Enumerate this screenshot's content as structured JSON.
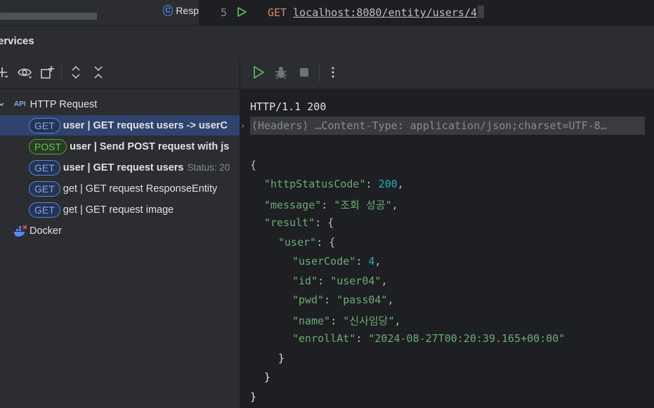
{
  "editor": {
    "tab_label": "Resp",
    "tab_icon": "class-icon",
    "line_number": "5",
    "code_method": "GET",
    "code_url": "localhost:8080/entity/users/4"
  },
  "services": {
    "title": "ervices"
  },
  "tree": {
    "root_icon_text": "API",
    "root_label": "HTTP Request",
    "items": [
      {
        "method": "GET",
        "label": "user  |  GET request users -> userC",
        "status": ""
      },
      {
        "method": "POST",
        "label": "user  |  Send POST request with js",
        "status": ""
      },
      {
        "method": "GET",
        "label": "user  |  GET request users",
        "status": "Status: 20"
      },
      {
        "method": "GET",
        "label": "get  |  GET request ResponseEntity",
        "status": ""
      },
      {
        "method": "GET",
        "label": "get  |  GET request image",
        "status": ""
      }
    ],
    "docker_label": "Docker"
  },
  "response": {
    "status_line": "HTTP/1.1 200",
    "headers_line": "(Headers) …Content-Type: application/json;charset=UTF-8…",
    "body": {
      "open": "{",
      "httpStatusCode_key": "\"httpStatusCode\"",
      "httpStatusCode_val": "200",
      "message_key": "\"message\"",
      "message_val": "\"조회 성공\"",
      "result_key": "\"result\"",
      "user_key": "\"user\"",
      "userCode_key": "\"userCode\"",
      "userCode_val": "4",
      "id_key": "\"id\"",
      "id_val": "\"user04\"",
      "pwd_key": "\"pwd\"",
      "pwd_val": "\"pass04\"",
      "name_key": "\"name\"",
      "name_val": "\"신사임당\"",
      "enrollAt_key": "\"enrollAt\"",
      "enrollAt_val": "\"2024-08-27T00:20:39.165+00:00\"",
      "close": "}"
    }
  },
  "colors": {
    "accent": "#548af7",
    "run_green": "#5fb865",
    "selected_row": "#2e436e",
    "json_key": "#6aab73",
    "json_number": "#2aacb8"
  }
}
